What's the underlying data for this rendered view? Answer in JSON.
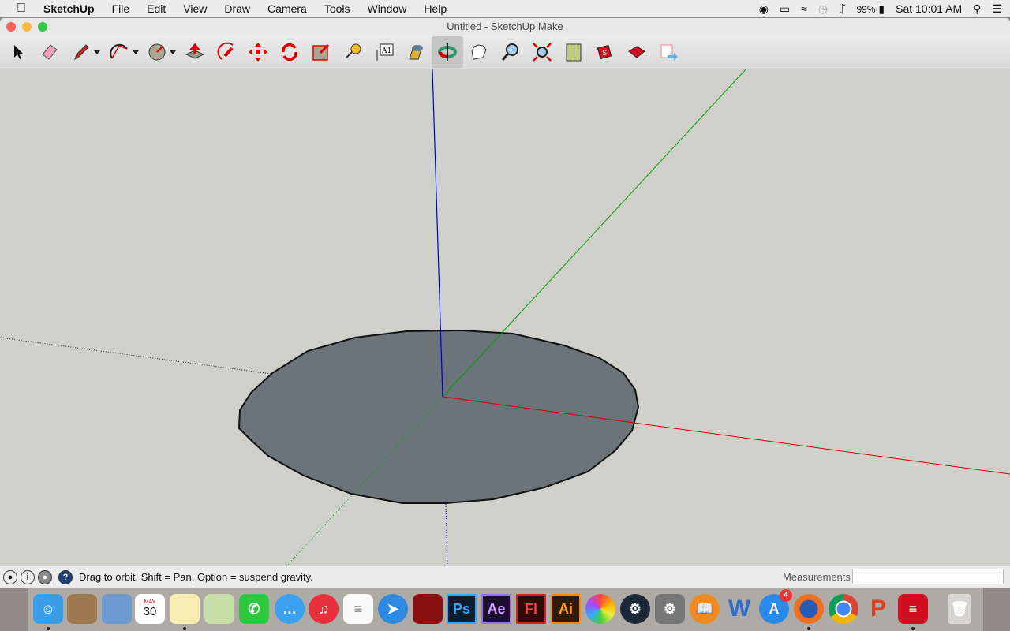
{
  "menubar": {
    "app": "SketchUp",
    "items": [
      "File",
      "Edit",
      "View",
      "Draw",
      "Camera",
      "Tools",
      "Window",
      "Help"
    ],
    "battery": "99%",
    "clock": "Sat 10:01 AM"
  },
  "window": {
    "title": "Untitled - SketchUp Make"
  },
  "toolbar": {
    "tools": [
      "select",
      "eraser",
      "pencil",
      "arc",
      "circle",
      "push-pull",
      "follow-me",
      "move",
      "rotate",
      "scale",
      "tape-measure",
      "text",
      "paint-bucket",
      "orbit",
      "pan",
      "zoom",
      "zoom-extents",
      "add-location",
      "3d-warehouse",
      "extension-warehouse",
      "send-to-layout"
    ],
    "active": "orbit"
  },
  "statusbar": {
    "hint": "Drag to orbit. Shift = Pan, Option = suspend gravity.",
    "measurements_label": "Measurements",
    "measurements_value": "",
    "help": "?"
  },
  "dock": {
    "apps": [
      "Finder",
      "Contacts",
      "Preview",
      "Calendar",
      "Notes",
      "Maps",
      "FaceTime",
      "Messages",
      "iTunes",
      "Reminders",
      "Safari",
      "Photo Booth",
      "Photoshop",
      "After Effects",
      "Flash",
      "Illustrator",
      "Photos",
      "Steam",
      "System Preferences",
      "iBooks",
      "Word",
      "App Store",
      "Firefox",
      "Chrome",
      "PowerPoint",
      "SketchUp",
      "Trash"
    ],
    "calendar_month": "MAY",
    "calendar_day": "30",
    "ps": "Ps",
    "ae": "Ae",
    "fl": "Fl",
    "ai": "Ai",
    "word": "W",
    "ppt": "P",
    "appstore_badge": "4"
  },
  "colors": {
    "axis_red": "#d00000",
    "axis_green": "#00a000",
    "axis_blue": "#0000d0",
    "face": "#6b747b",
    "background": "#d0d0cb"
  }
}
